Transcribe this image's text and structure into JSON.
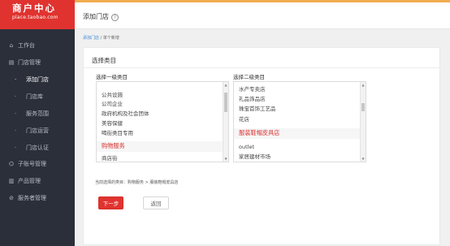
{
  "brand": {
    "title": "商户中心",
    "subtitle": "place.taobao.com"
  },
  "sidebar": {
    "items": [
      {
        "icon": "home-icon",
        "glyph": "⌂",
        "label": "工作台"
      },
      {
        "icon": "store-icon",
        "glyph": "▤",
        "label": "门店管理"
      },
      {
        "label": "添加门店",
        "active": true
      },
      {
        "label": "门店库"
      },
      {
        "label": "服务范围"
      },
      {
        "label": "门店运营"
      },
      {
        "label": "门店认证"
      },
      {
        "icon": "account-icon",
        "glyph": "⌬",
        "label": "子账号管理"
      },
      {
        "icon": "product-icon",
        "glyph": "▥",
        "label": "产品管理"
      },
      {
        "icon": "service-icon",
        "glyph": "⊘",
        "label": "服务者管理"
      }
    ]
  },
  "header": {
    "title": "添加门店",
    "help": "?"
  },
  "breadcrumb": {
    "link": "添加门店",
    "separator": "/",
    "current": "单个新增"
  },
  "panel": {
    "title": "选择类目",
    "first_label": "选择一级类目",
    "second_label": "选择二级类目",
    "first_items": [
      "公共设施",
      "公司企业",
      "政府机构及社会团体",
      "美容保健",
      "喝街类目专用",
      "购物服务",
      "商店街"
    ],
    "first_selected": "购物服务",
    "second_items": [
      "水产专卖店",
      "礼品饰品店",
      "珠宝首饰工艺品",
      "花店",
      "服装鞋帽皮具店",
      "outlet",
      "家居建材市场"
    ],
    "second_selected": "服装鞋帽皮具店",
    "current_text": "当前选择的类目：购物服务 > 服装鞋帽皮具店",
    "next_label": "下一步",
    "back_label": "返回"
  }
}
